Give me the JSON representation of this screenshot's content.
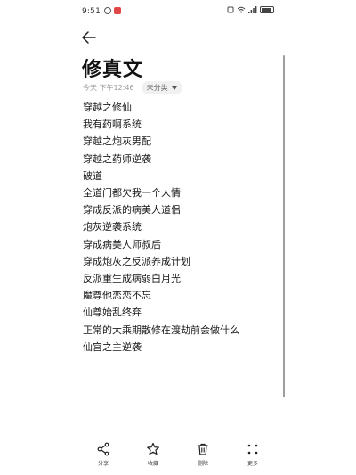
{
  "status_bar": {
    "time": "9:51",
    "signal_text": "ᵃᵢˡ"
  },
  "note": {
    "title": "修真文",
    "date": "今天 下午12:46",
    "category": "未分类",
    "lines": [
      "穿越之修仙",
      "我有药啊系统",
      "穿越之炮灰男配",
      "穿越之药师逆袭",
      "破道",
      "全道门都欠我一个人情",
      "穿成反派的病美人道侣",
      "炮灰逆袭系统",
      "穿成病美人师叔后",
      "穿成炮灰之反派养成计划",
      "反派重生成病弱白月光",
      "魔尊他恋恋不忘",
      "仙尊始乱终弃",
      "正常的大乘期散修在渡劫前会做什么",
      "仙宫之主逆袭"
    ]
  },
  "toolbar": {
    "share_label": "分享",
    "favorite_label": "收藏",
    "delete_label": "删除",
    "more_label": "更多"
  },
  "icons": {
    "back": "back-arrow-icon",
    "share": "share-icon",
    "favorite": "star-icon",
    "delete": "trash-icon",
    "more": "more-dots-icon"
  },
  "colors": {
    "background": "#ffffff",
    "text": "#1a1a1a",
    "meta_text": "#9a9a9a",
    "chip_bg": "#f1f1f1",
    "scrollbar": "#9e9e9e",
    "status_red": "#e04848"
  }
}
